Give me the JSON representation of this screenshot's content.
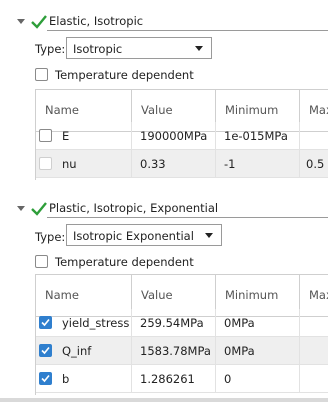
{
  "sections": [
    {
      "title": "Elastic, Isotropic",
      "type_label": "Type:",
      "type_value": "Isotropic",
      "temp_label": "Temperature dependent",
      "columns": [
        "Name",
        "Value",
        "Minimum",
        "Max"
      ],
      "rows": [
        {
          "name": "E",
          "value": "190000MPa",
          "min": "1e-015MPa",
          "max": "",
          "checked": false
        },
        {
          "name": "nu",
          "value": "0.33",
          "min": "-1",
          "max": "0.5",
          "checked": false
        }
      ]
    },
    {
      "title": "Plastic, Isotropic, Exponential",
      "type_label": "Type:",
      "type_value": "Isotropic Exponential",
      "temp_label": "Temperature dependent",
      "columns": [
        "Name",
        "Value",
        "Minimum",
        "Max"
      ],
      "rows": [
        {
          "name": "yield_stress",
          "value": "259.54MPa",
          "min": "0MPa",
          "max": "",
          "checked": true
        },
        {
          "name": "Q_inf",
          "value": "1583.78MPa",
          "min": "0MPa",
          "max": "",
          "checked": true
        },
        {
          "name": "b",
          "value": "1.286261",
          "min": "0",
          "max": "",
          "checked": true
        }
      ]
    }
  ],
  "colors": {
    "check_green": "#2e9e3a",
    "checkbox_blue": "#2f7fce",
    "row_shade": "#efefef"
  }
}
